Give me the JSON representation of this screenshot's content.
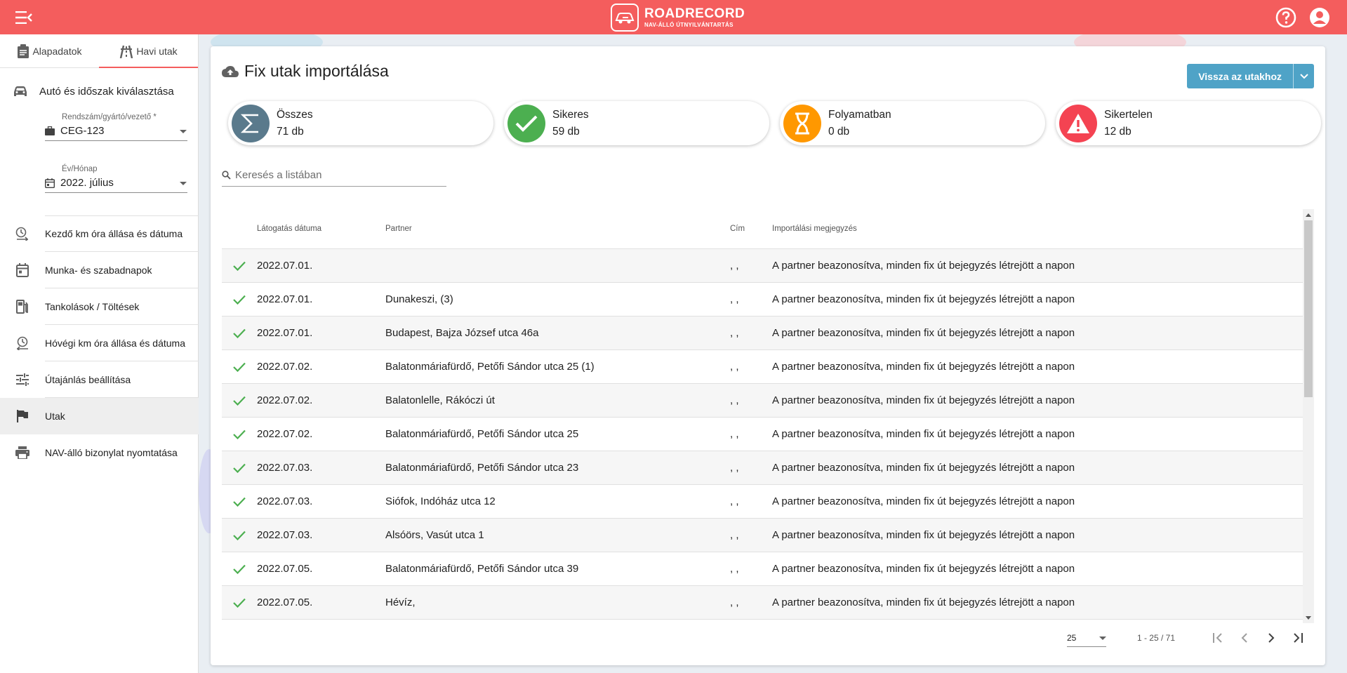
{
  "app": {
    "brand_name": "ROADRECORD",
    "brand_tagline": "NAV-ÁLLÓ ÚTNYILVÁNTARTÁS",
    "header_color": "#f45d5d"
  },
  "sidebar": {
    "tabs": [
      {
        "label": "Alapadatok",
        "icon": "clipboard-icon",
        "active": false
      },
      {
        "label": "Havi utak",
        "icon": "road-icon",
        "active": true
      }
    ],
    "section_title": "Autó és időszak kiválasztása",
    "vehicle_field": {
      "label": "Rendszám/gyártó/vezető *",
      "value": "CEG-123"
    },
    "period_field": {
      "label": "Év/Hónap",
      "value": "2022. július"
    },
    "nav": [
      {
        "label": "Kezdő km óra állása és dátuma",
        "icon": "odometer-start-icon"
      },
      {
        "label": "Munka- és szabadnapok",
        "icon": "calendar-icon"
      },
      {
        "label": "Tankolások / Töltések",
        "icon": "fuel-icon"
      },
      {
        "label": "Hóvégi km óra állása és dátuma",
        "icon": "odometer-end-icon"
      },
      {
        "label": "Útajánlás beállítása",
        "icon": "tune-icon"
      },
      {
        "label": "Utak",
        "icon": "flag-icon",
        "active": true
      },
      {
        "label": "NAV-álló bizonylat nyomtatása",
        "icon": "print-icon"
      }
    ]
  },
  "main": {
    "title": "Fix utak importálása",
    "back_button": "Vissza az utakhoz",
    "stats": [
      {
        "label": "Összes",
        "value": "71 db",
        "color": "#5a7a8c",
        "icon": "sigma-icon"
      },
      {
        "label": "Sikeres",
        "value": "59 db",
        "color": "#4caf50",
        "icon": "check-icon"
      },
      {
        "label": "Folyamatban",
        "value": "0 db",
        "color": "#ff9800",
        "icon": "hourglass-icon"
      },
      {
        "label": "Sikertelen",
        "value": "12 db",
        "color": "#f44352",
        "icon": "warning-icon"
      }
    ],
    "search_placeholder": "Keresés a listában",
    "columns": [
      "Látogatás dátuma",
      "Partner",
      "Cím",
      "Importálási megjegyzés"
    ],
    "rows": [
      {
        "date": "2022.07.01.",
        "partner": "",
        "cim": ", ,",
        "note": "A partner beazonosítva, minden fix út bejegyzés létrejött a napon"
      },
      {
        "date": "2022.07.01.",
        "partner": "Dunakeszi, (3)",
        "cim": ", ,",
        "note": "A partner beazonosítva, minden fix út bejegyzés létrejött a napon"
      },
      {
        "date": "2022.07.01.",
        "partner": "Budapest, Bajza József utca 46a",
        "cim": ", ,",
        "note": "A partner beazonosítva, minden fix út bejegyzés létrejött a napon"
      },
      {
        "date": "2022.07.02.",
        "partner": "Balatonmáriafürdő, Petőfi Sándor utca 25 (1)",
        "cim": ", ,",
        "note": "A partner beazonosítva, minden fix út bejegyzés létrejött a napon"
      },
      {
        "date": "2022.07.02.",
        "partner": "Balatonlelle, Rákóczi út",
        "cim": ", ,",
        "note": "A partner beazonosítva, minden fix út bejegyzés létrejött a napon"
      },
      {
        "date": "2022.07.02.",
        "partner": "Balatonmáriafürdő, Petőfi Sándor utca 25",
        "cim": ", ,",
        "note": "A partner beazonosítva, minden fix út bejegyzés létrejött a napon"
      },
      {
        "date": "2022.07.03.",
        "partner": "Balatonmáriafürdő, Petőfi Sándor utca 23",
        "cim": ", ,",
        "note": "A partner beazonosítva, minden fix út bejegyzés létrejött a napon"
      },
      {
        "date": "2022.07.03.",
        "partner": "Siófok, Indóház utca 12",
        "cim": ", ,",
        "note": "A partner beazonosítva, minden fix út bejegyzés létrejött a napon"
      },
      {
        "date": "2022.07.03.",
        "partner": "Alsóörs, Vasút utca 1",
        "cim": ", ,",
        "note": "A partner beazonosítva, minden fix út bejegyzés létrejött a napon"
      },
      {
        "date": "2022.07.05.",
        "partner": "Balatonmáriafürdő, Petőfi Sándor utca 39",
        "cim": ", ,",
        "note": "A partner beazonosítva, minden fix út bejegyzés létrejött a napon"
      },
      {
        "date": "2022.07.05.",
        "partner": "Hévíz,",
        "cim": ", ,",
        "note": "A partner beazonosítva, minden fix út bejegyzés létrejött a napon"
      }
    ],
    "paginator": {
      "page_size": "25",
      "range": "1 - 25 / 71"
    }
  }
}
